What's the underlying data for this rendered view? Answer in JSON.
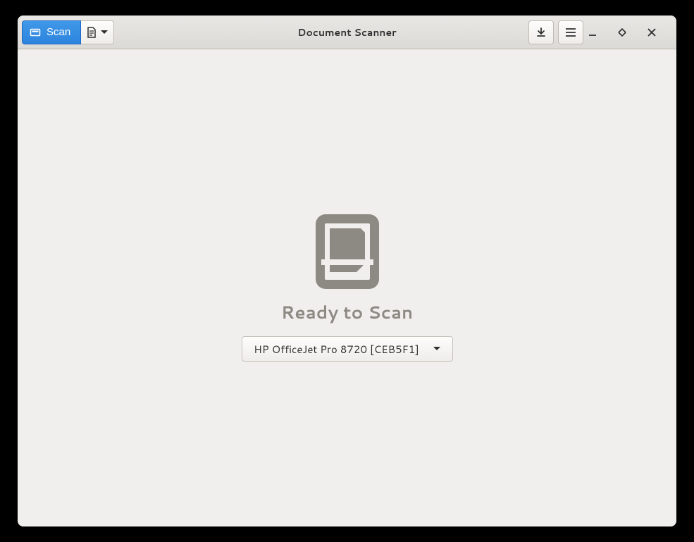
{
  "header": {
    "title": "Document Scanner",
    "scan_label": "Scan"
  },
  "main": {
    "status_title": "Ready to Scan",
    "scanner_name": "HP OfficeJet Pro 8720 [CEB5F1]"
  }
}
